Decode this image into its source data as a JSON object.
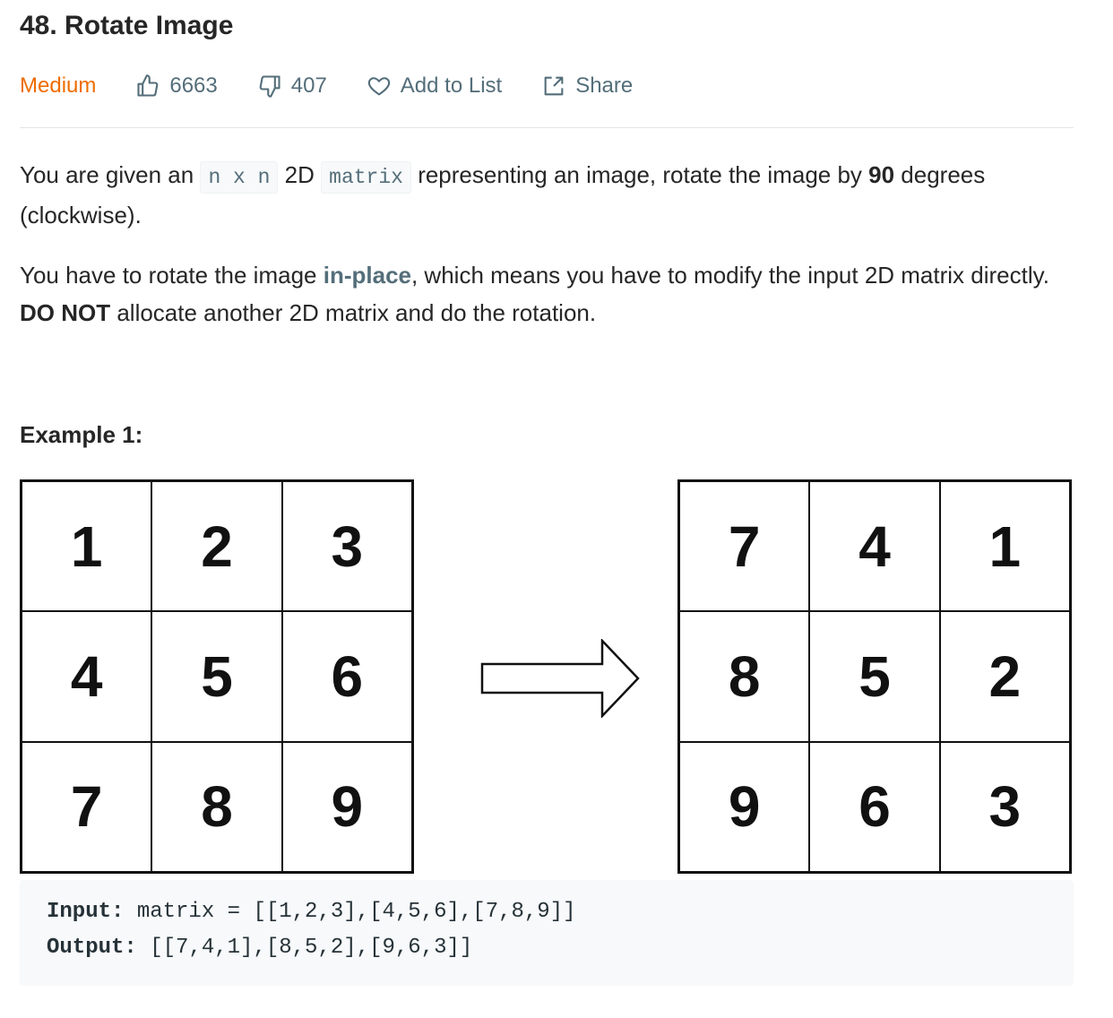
{
  "problem": {
    "title": "48. Rotate Image",
    "difficulty": "Medium",
    "likes": "6663",
    "dislikes": "407",
    "add_to_list": "Add to List",
    "share": "Share"
  },
  "description": {
    "p1": {
      "t1": "You are given an ",
      "code1": "n x n",
      "t2": " 2D ",
      "code2": "matrix",
      "t3": " representing an image, rotate the image by ",
      "bold": "90",
      "t4": " degrees (clockwise)."
    },
    "p2": {
      "t1": "You have to rotate the image ",
      "link": "in-place",
      "t2": ", which means you have to modify the input 2D matrix directly. ",
      "bold": "DO NOT",
      "t3": " allocate another 2D matrix and do the rotation."
    }
  },
  "example": {
    "title": "Example 1:",
    "input_grid": [
      "1",
      "2",
      "3",
      "4",
      "5",
      "6",
      "7",
      "8",
      "9"
    ],
    "output_grid": [
      "7",
      "4",
      "1",
      "8",
      "5",
      "2",
      "9",
      "6",
      "3"
    ],
    "input_label": "Input:",
    "input_value": " matrix = [[1,2,3],[4,5,6],[7,8,9]]",
    "output_label": "Output:",
    "output_value": " [[7,4,1],[8,5,2],[9,6,3]]"
  },
  "colors": {
    "difficulty": "#ef6c00",
    "meta": "#546e7a",
    "text": "#262626"
  }
}
